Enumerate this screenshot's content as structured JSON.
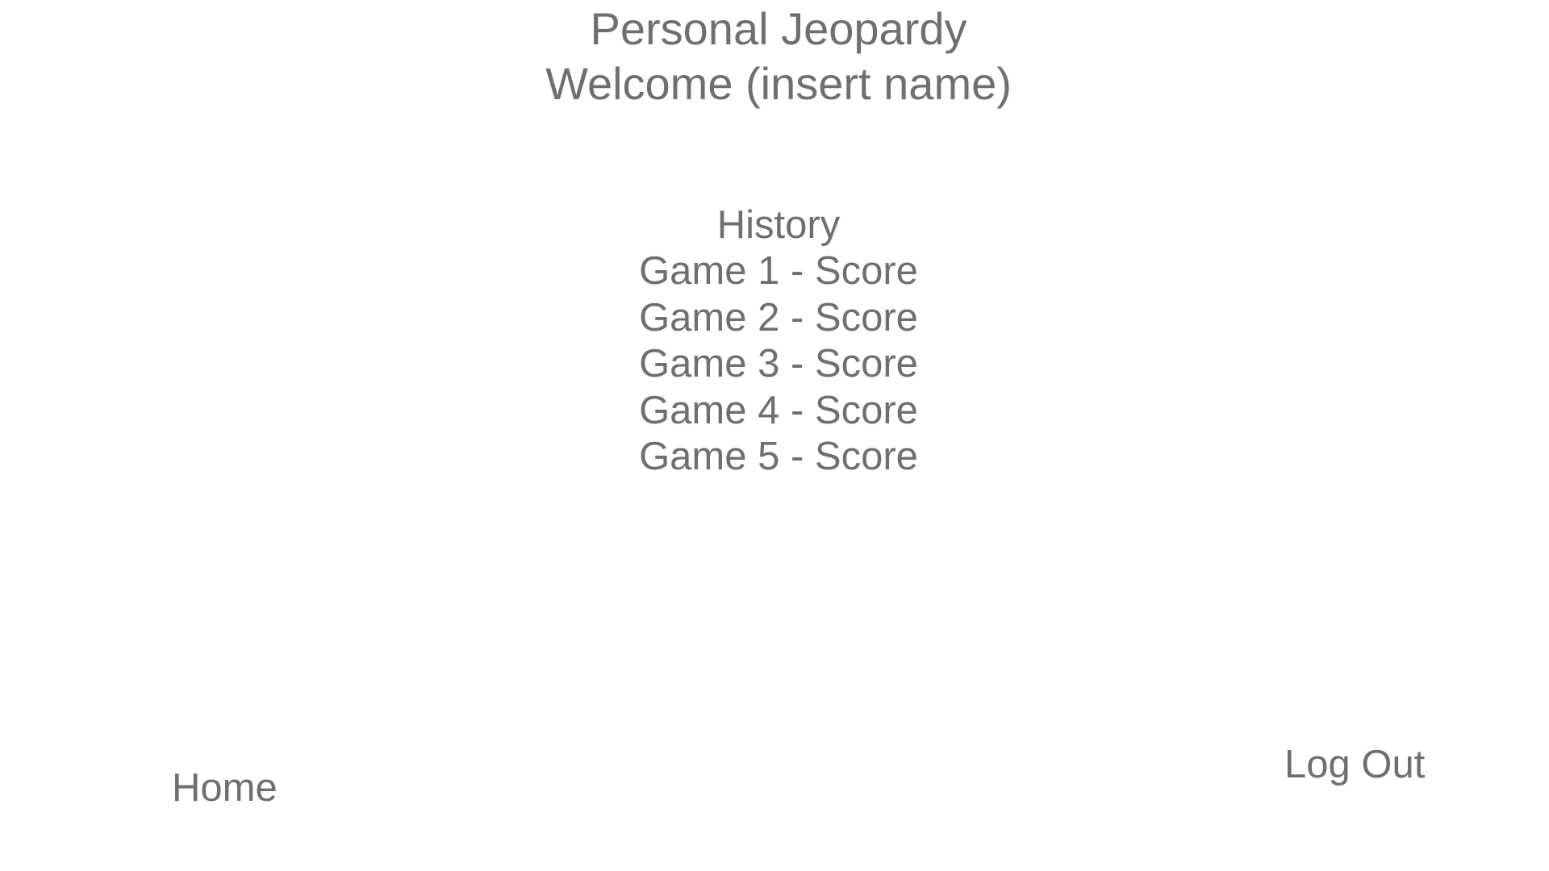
{
  "header": {
    "title": "Personal Jeopardy",
    "welcome": "Welcome (insert name)"
  },
  "history": {
    "title": "History",
    "games": [
      "Game 1 - Score",
      "Game 2 - Score",
      "Game 3 - Score",
      "Game 4 - Score",
      "Game 5 - Score"
    ]
  },
  "nav": {
    "home": "Home",
    "logout": "Log Out"
  },
  "colors": {
    "text": "#6f6f6f",
    "background": "#ffffff"
  }
}
